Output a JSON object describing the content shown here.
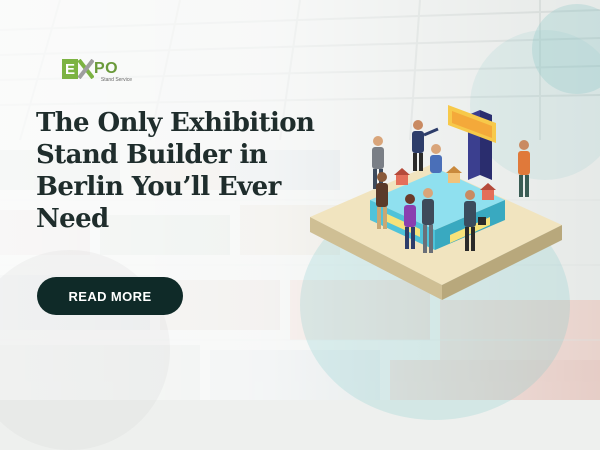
{
  "logo": {
    "text_e": "E",
    "text_rest": "PO",
    "tagline": "Stand Service"
  },
  "headline": {
    "line1": "The Only Exhibition",
    "line2": "Stand Builder in",
    "line3": "Berlin You’ll Ever",
    "line4": "Need"
  },
  "cta": {
    "label": "READ MORE"
  },
  "colors": {
    "headline": "#1f2d2c",
    "button": "#0f2a28",
    "accent_green": "#7cb342",
    "stand_teal": "#4fc3d9"
  }
}
